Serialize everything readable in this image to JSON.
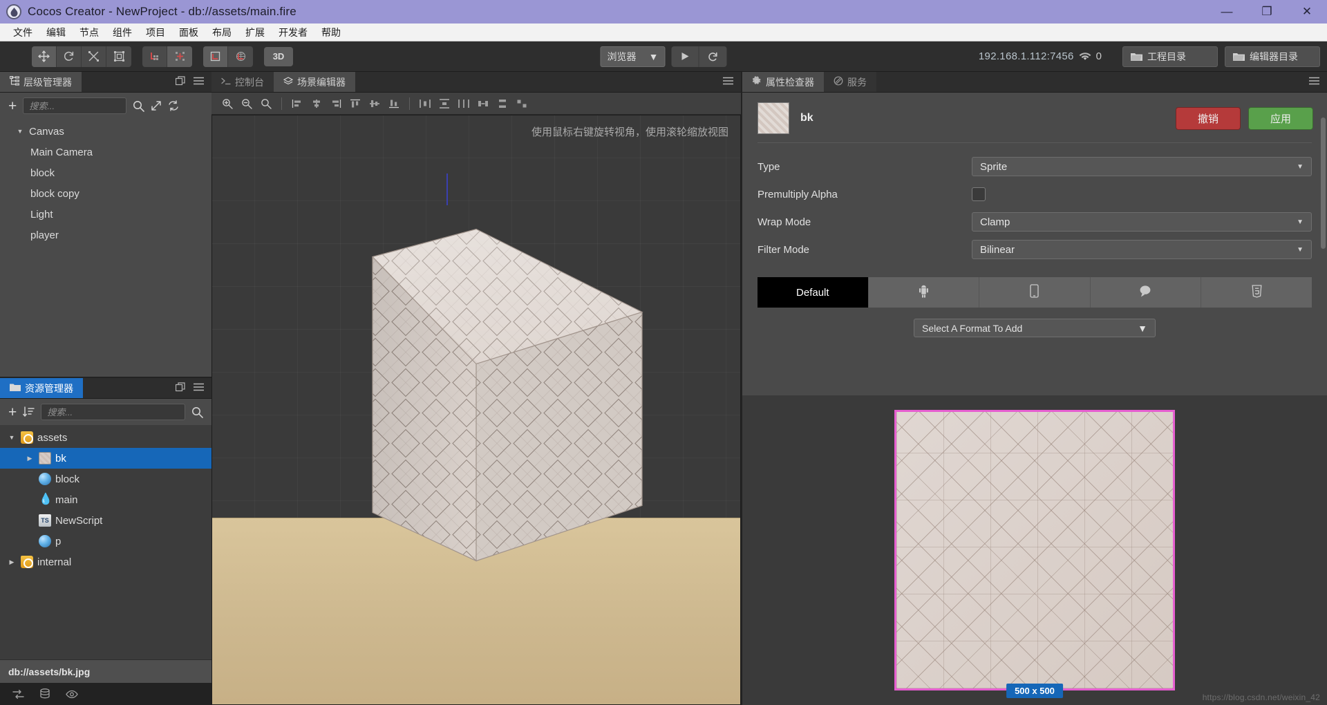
{
  "titlebar": {
    "title": "Cocos Creator - NewProject - db://assets/main.fire",
    "logo_icon": "cocos-droplet-icon",
    "minimize": "—",
    "maximize": "❐",
    "close": "✕"
  },
  "menubar": {
    "items": [
      {
        "label": "文件"
      },
      {
        "label": "编辑"
      },
      {
        "label": "节点"
      },
      {
        "label": "组件"
      },
      {
        "label": "项目"
      },
      {
        "label": "面板"
      },
      {
        "label": "布局"
      },
      {
        "label": "扩展"
      },
      {
        "label": "开发者"
      },
      {
        "label": "帮助"
      }
    ]
  },
  "toolbar": {
    "transform_tools": [
      {
        "name": "move-tool",
        "icon": "move-icon"
      },
      {
        "name": "rotate-tool",
        "icon": "rotate-icon"
      },
      {
        "name": "scale-tool",
        "icon": "scale-icon"
      },
      {
        "name": "rect-tool",
        "icon": "rect-transform-icon"
      }
    ],
    "pivot_tools": [
      {
        "name": "pivot-tool",
        "icon": "pivot-icon"
      },
      {
        "name": "center-tool",
        "icon": "center-icon"
      }
    ],
    "coord_tools": [
      {
        "name": "local-tool",
        "icon": "local-axis-icon"
      },
      {
        "name": "global-tool",
        "icon": "global-axis-icon"
      }
    ],
    "mode_3d_label": "3D",
    "preview_target": "浏览器",
    "play_label": "▶",
    "refresh_label": "↻",
    "server_address": "192.168.1.112:7456",
    "wifi_icon": "wifi-icon",
    "connection_count": "0",
    "project_dir_label": "工程目录",
    "editor_dir_label": "编辑器目录"
  },
  "hierarchy": {
    "tab_label": "层级管理器",
    "tab_icon": "hierarchy-icon",
    "add_icon": "plus-icon",
    "search_placeholder": "搜索...",
    "search_value": "",
    "search_icon": "search-icon",
    "expand_icon": "expand-icon",
    "sync_icon": "sync-icon",
    "menu_icon": "hamburger-icon",
    "maximize_icon": "maximize-panel-icon",
    "nodes": [
      {
        "label": "Canvas",
        "depth": 0,
        "expanded": true,
        "icon": "none"
      },
      {
        "label": "Main Camera",
        "depth": 1,
        "expanded": false,
        "icon": "none"
      },
      {
        "label": "block",
        "depth": 1,
        "expanded": false,
        "icon": "none"
      },
      {
        "label": "block copy",
        "depth": 1,
        "expanded": false,
        "icon": "none"
      },
      {
        "label": "Light",
        "depth": 1,
        "expanded": false,
        "icon": "none"
      },
      {
        "label": "player",
        "depth": 1,
        "expanded": false,
        "icon": "none"
      }
    ]
  },
  "assets": {
    "tab_label": "资源管理器",
    "tab_icon": "folder-icon",
    "add_icon": "plus-icon",
    "sort_icon": "sort-icon",
    "search_placeholder": "搜索...",
    "search_value": "",
    "search_icon": "search-icon",
    "maximize_icon": "maximize-panel-icon",
    "menu_icon": "hamburger-icon",
    "items": [
      {
        "label": "assets",
        "depth": 0,
        "expanded": true,
        "icon": "folder",
        "selected": false
      },
      {
        "label": "bk",
        "depth": 1,
        "expanded": false,
        "icon": "texture",
        "selected": true
      },
      {
        "label": "block",
        "depth": 1,
        "expanded": null,
        "icon": "sphere",
        "selected": false
      },
      {
        "label": "main",
        "depth": 1,
        "expanded": null,
        "icon": "fire",
        "selected": false
      },
      {
        "label": "NewScript",
        "depth": 1,
        "expanded": null,
        "icon": "ts",
        "selected": false
      },
      {
        "label": "p",
        "depth": 1,
        "expanded": null,
        "icon": "sphere",
        "selected": false
      },
      {
        "label": "internal",
        "depth": 0,
        "expanded": false,
        "icon": "folder",
        "selected": false
      }
    ],
    "status_path": "db://assets/bk.jpg"
  },
  "bottombar": {
    "icons": [
      {
        "name": "refresh-assets-icon",
        "glyph": "⇄"
      },
      {
        "name": "database-icon",
        "glyph": "☲"
      },
      {
        "name": "eye-icon",
        "glyph": "◉"
      }
    ]
  },
  "scene": {
    "console_tab": "控制台",
    "console_icon": "console-icon",
    "scene_tab": "场景编辑器",
    "scene_icon": "scene-icon",
    "menu_icon": "hamburger-icon",
    "hint": "使用鼠标右键旋转视角，使用滚轮缩放视图",
    "tools": [
      {
        "name": "zoom-in-icon"
      },
      {
        "name": "zoom-out-icon"
      },
      {
        "name": "zoom-reset-icon"
      },
      {
        "name": "align-left-icon"
      },
      {
        "name": "align-hcenter-icon"
      },
      {
        "name": "align-right-icon"
      },
      {
        "name": "align-top-icon"
      },
      {
        "name": "align-vcenter-icon"
      },
      {
        "name": "align-bottom-icon"
      },
      {
        "name": "distribute-h-icon"
      },
      {
        "name": "distribute-v-icon"
      },
      {
        "name": "distribute-equal-icon"
      },
      {
        "name": "space-h-icon"
      },
      {
        "name": "space-v-icon"
      },
      {
        "name": "space-both-icon"
      }
    ]
  },
  "inspector": {
    "tabs": [
      {
        "label": "属性检查器",
        "icon": "gear-icon",
        "active": true
      },
      {
        "label": "服务",
        "icon": "service-icon",
        "active": false
      }
    ],
    "menu_icon": "hamburger-icon",
    "asset_name": "bk",
    "asset_thumb_icon": "texture-thumbnail",
    "revert_label": "撤销",
    "apply_label": "应用",
    "properties": [
      {
        "label": "Type",
        "kind": "select",
        "value": "Sprite"
      },
      {
        "label": "Premultiply Alpha",
        "kind": "checkbox",
        "value": false
      },
      {
        "label": "Wrap Mode",
        "kind": "select",
        "value": "Clamp"
      },
      {
        "label": "Filter Mode",
        "kind": "select",
        "value": "Bilinear"
      }
    ],
    "format_tabs": [
      {
        "label": "Default",
        "icon": "",
        "active": true
      },
      {
        "label": "",
        "icon": "android-icon",
        "active": false
      },
      {
        "label": "",
        "icon": "ios-device-icon",
        "active": false
      },
      {
        "label": "",
        "icon": "wechat-icon",
        "active": false
      },
      {
        "label": "",
        "icon": "html5-icon",
        "active": false
      }
    ],
    "format_add_label": "Select A Format To Add",
    "preview_size_badge": "500 x 500"
  },
  "watermark": "https://blog.csdn.net/weixin_42",
  "colors": {
    "title_bar": "#9a96d4",
    "menu_bar": "#f2f2f2",
    "toolbar": "#2e2e2e",
    "panel": "#4a4a4a",
    "selection_blue": "#1667b8",
    "revert_red": "#b53a3a",
    "apply_green": "#59a04b",
    "preview_border": "#e65fd0",
    "ground": "#d9c59b"
  }
}
